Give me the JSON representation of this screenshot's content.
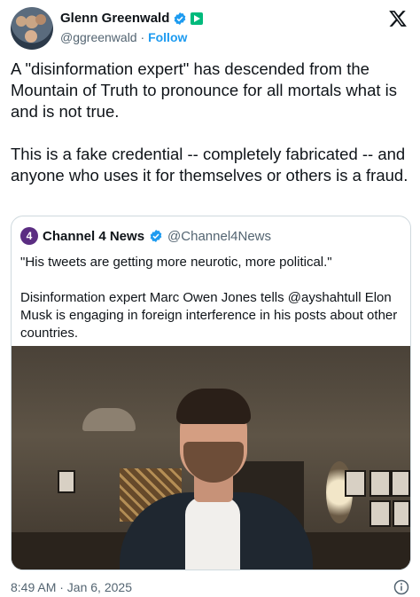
{
  "author": {
    "name": "Glenn Greenwald",
    "handle": "@ggreenwald",
    "separator": "·",
    "follow_label": "Follow"
  },
  "tweet": {
    "paragraphs": [
      "A \"disinformation expert\" has descended from the Mountain of Truth to pronounce for all mortals what is and is not true.",
      "This is a fake credential -- completely fabricated -- and anyone who uses it for themselves or others is a fraud."
    ],
    "timestamp": "8:49 AM · Jan 6, 2025"
  },
  "quoted": {
    "avatar_text": "4",
    "name": "Channel 4 News",
    "handle": "@Channel4News",
    "paragraphs": [
      "\"His tweets are getting more neurotic, more political.\"",
      "Disinformation expert Marc Owen Jones tells @ayshahtull Elon Musk is engaging in foreign interference in his posts about other countries."
    ]
  },
  "colors": {
    "accent": "#1d9bf0",
    "verified": "#1d9bf0",
    "subscription_badge": "#00ba7c",
    "secondary_text": "#536471"
  },
  "icons": {
    "verified": "verified-badge-icon",
    "subscription": "subscription-badge-icon",
    "platform": "x-logo-icon",
    "info": "info-icon"
  }
}
